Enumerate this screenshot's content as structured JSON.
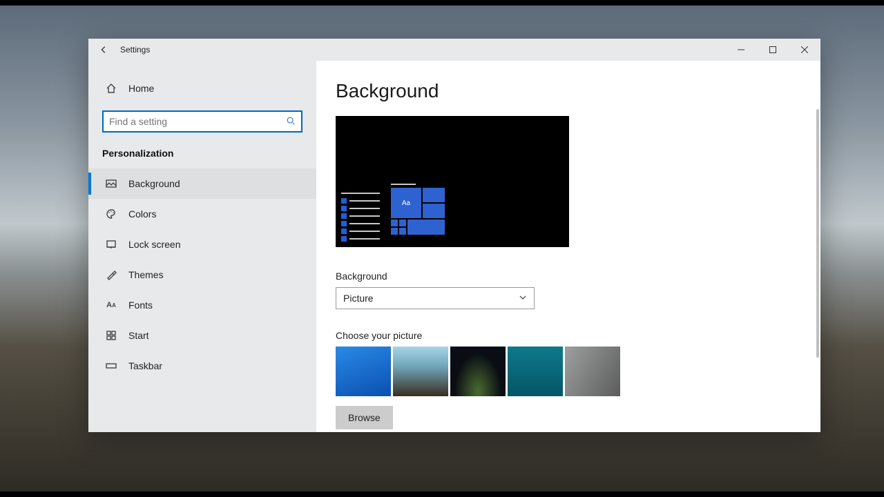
{
  "window": {
    "title": "Settings"
  },
  "sidebar": {
    "home": "Home",
    "search_placeholder": "Find a setting",
    "section": "Personalization",
    "items": [
      {
        "label": "Background"
      },
      {
        "label": "Colors"
      },
      {
        "label": "Lock screen"
      },
      {
        "label": "Themes"
      },
      {
        "label": "Fonts"
      },
      {
        "label": "Start"
      },
      {
        "label": "Taskbar"
      }
    ]
  },
  "main": {
    "heading": "Background",
    "preview_sample_text": "Aa",
    "bg_label": "Background",
    "bg_select_value": "Picture",
    "choose_label": "Choose your picture",
    "browse_label": "Browse"
  }
}
